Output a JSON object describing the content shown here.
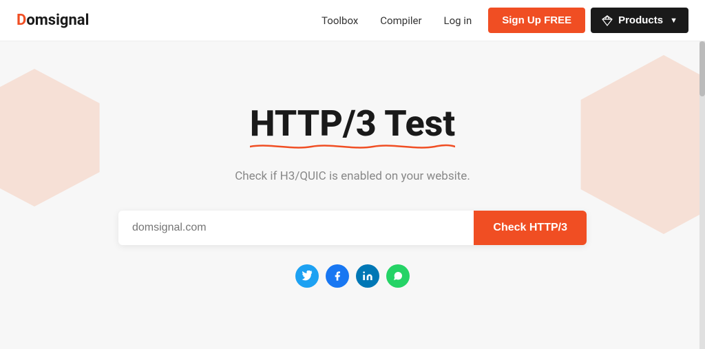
{
  "navbar": {
    "logo_prefix": "D",
    "logo_suffix": "omsignal",
    "nav_links": [
      {
        "label": "Toolbox"
      },
      {
        "label": "Compiler"
      },
      {
        "label": "Log in"
      }
    ],
    "signup_label": "Sign Up FREE",
    "products_label": "Products"
  },
  "hero": {
    "title": "HTTP/3 Test",
    "subtitle": "Check if H3/QUIC is enabled on your website.",
    "search_placeholder": "domsignal.com",
    "check_button_label": "Check HTTP/3"
  },
  "social": [
    {
      "name": "twitter",
      "label": "t"
    },
    {
      "name": "facebook",
      "label": "f"
    },
    {
      "name": "linkedin",
      "label": "in"
    },
    {
      "name": "whatsapp",
      "label": "w"
    }
  ]
}
